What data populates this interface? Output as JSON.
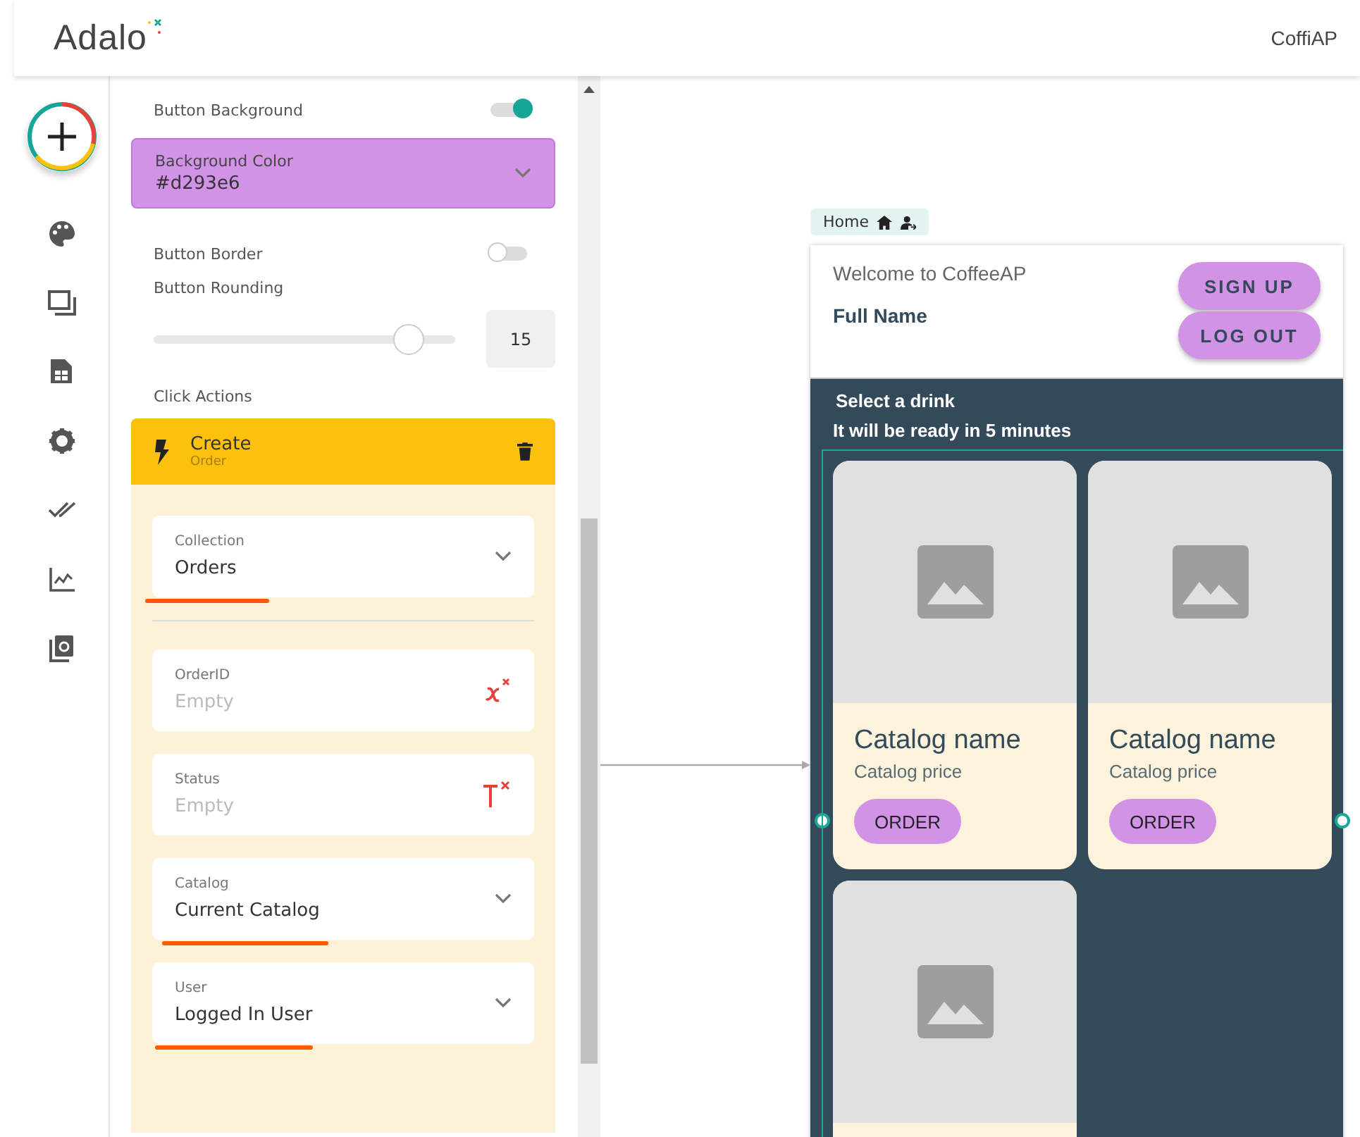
{
  "header": {
    "logo": "Adalo",
    "app_name": "CoffiAP"
  },
  "panel": {
    "button_background": {
      "label": "Button Background",
      "on": true
    },
    "background_color": {
      "label": "Background Color",
      "value": "#d293e6"
    },
    "button_border": {
      "label": "Button Border",
      "on": false
    },
    "rounding": {
      "label": "Button Rounding",
      "level": 0.845,
      "value": "15"
    },
    "click_actions": {
      "label": "Click Actions",
      "action": {
        "title": "Create",
        "subtitle": "Order"
      },
      "collection": {
        "label": "Collection",
        "value": "Orders",
        "kind": "select",
        "highlighted": true
      },
      "fields": [
        {
          "label": "OrderID",
          "placeholder": "Empty",
          "kind": "number",
          "highlighted": false
        },
        {
          "label": "Status",
          "placeholder": "Empty",
          "kind": "text",
          "highlighted": false
        },
        {
          "label": "Catalog",
          "value": "Current Catalog",
          "kind": "select",
          "highlighted": true
        },
        {
          "label": "User",
          "value": "Logged In User",
          "kind": "select",
          "highlighted": true
        }
      ]
    }
  },
  "canvas": {
    "screen_tag": "Home",
    "phone": {
      "welcome": "Welcome to CoffeeAP",
      "full_name": "Full Name",
      "buttons": [
        "SIGN UP",
        "LOG OUT"
      ],
      "title": "Select a drink",
      "subtitle": "It will be ready in 5 minutes",
      "cards": [
        {
          "kind": "full",
          "name": "Catalog name",
          "price": "Catalog price",
          "button": "ORDER"
        },
        {
          "kind": "full",
          "name": "Catalog name",
          "price": "Catalog price",
          "button": "ORDER"
        },
        {
          "kind": "image_only"
        }
      ]
    }
  }
}
